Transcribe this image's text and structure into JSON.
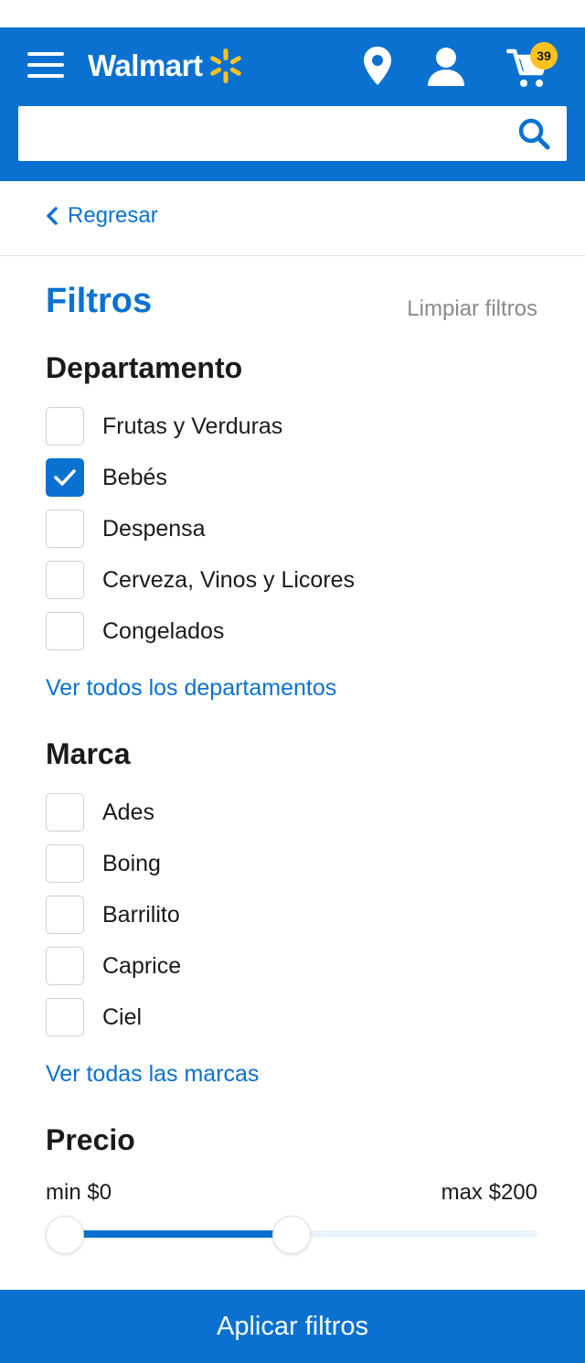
{
  "header": {
    "brand": "Walmart",
    "cart_count": "39",
    "search": {
      "value": "",
      "placeholder": ""
    },
    "icons": [
      "menu-icon",
      "walmart-spark-icon",
      "location-pin-icon",
      "account-icon",
      "cart-icon",
      "search-icon"
    ]
  },
  "nav": {
    "back_label": "Regresar"
  },
  "filters": {
    "title": "Filtros",
    "clear_label": "Limpiar filtros",
    "department": {
      "title": "Departamento",
      "options": [
        {
          "label": "Frutas y Verduras",
          "checked": false
        },
        {
          "label": "Bebés",
          "checked": true
        },
        {
          "label": "Despensa",
          "checked": false
        },
        {
          "label": "Cerveza, Vinos y Licores",
          "checked": false
        },
        {
          "label": "Congelados",
          "checked": false
        }
      ],
      "see_all": "Ver todos los departamentos"
    },
    "brand": {
      "title": "Marca",
      "options": [
        {
          "label": "Ades",
          "checked": false
        },
        {
          "label": "Boing",
          "checked": false
        },
        {
          "label": "Barrilito",
          "checked": false
        },
        {
          "label": "Caprice",
          "checked": false
        },
        {
          "label": "Ciel",
          "checked": false
        }
      ],
      "see_all": "Ver todas las marcas"
    },
    "price": {
      "title": "Precio",
      "min_label": "min $0",
      "max_label": "max $200",
      "range_min": 0,
      "range_max": 200,
      "selected_low": 0,
      "selected_high": 100
    }
  },
  "apply_label": "Aplicar filtros",
  "colors": {
    "primary": "#0a71d1",
    "badge": "#ffc220",
    "spark": "#ffc220",
    "muted_text": "#8a8a8a"
  }
}
